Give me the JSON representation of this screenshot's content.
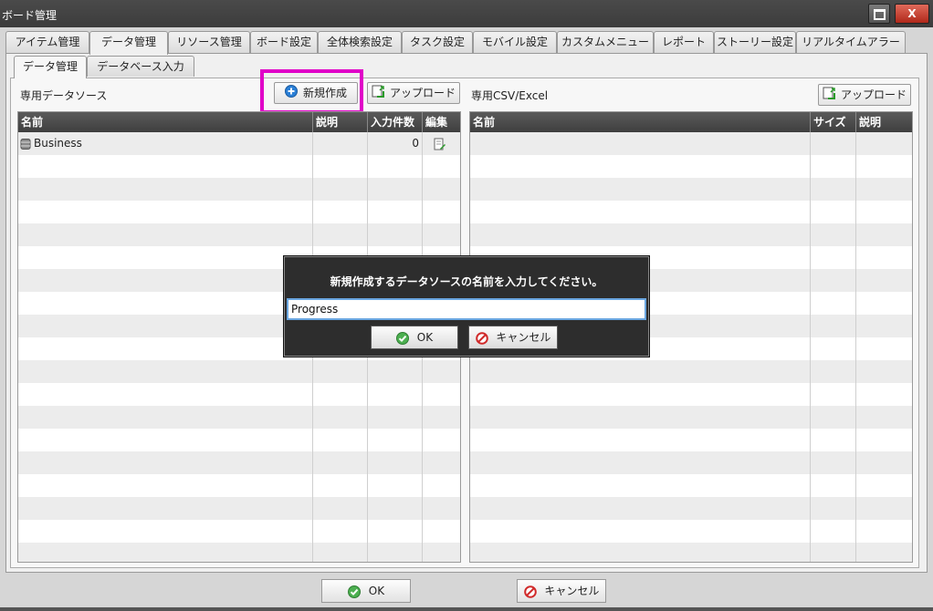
{
  "window": {
    "title": "ボード管理"
  },
  "main_tabs": [
    {
      "label": "アイテム管理"
    },
    {
      "label": "データ管理"
    },
    {
      "label": "リソース管理"
    },
    {
      "label": "ボード設定"
    },
    {
      "label": "全体検索設定"
    },
    {
      "label": "タスク設定"
    },
    {
      "label": "モバイル設定"
    },
    {
      "label": "カスタムメニュー"
    },
    {
      "label": "レポート"
    },
    {
      "label": "ストーリー設定"
    },
    {
      "label": "リアルタイムアラート"
    }
  ],
  "sub_tabs": [
    {
      "label": "データ管理"
    },
    {
      "label": "データベース入力"
    }
  ],
  "left_section": {
    "label": "専用データソース",
    "new_button": "新規作成",
    "upload_button": "アップロード",
    "columns": [
      "名前",
      "説明",
      "入力件数",
      "編集"
    ],
    "rows": [
      {
        "name": "Business",
        "description": "",
        "count": "0"
      }
    ]
  },
  "right_section": {
    "label": "専用CSV/Excel",
    "upload_button": "アップロード",
    "columns": [
      "名前",
      "サイズ",
      "説明"
    ]
  },
  "dialog": {
    "message": "新規作成するデータソースの名前を入力してください。",
    "input_value": "Progress",
    "ok_label": "OK",
    "cancel_label": "キャンセル"
  },
  "footer": {
    "ok_label": "OK",
    "cancel_label": "キャンセル"
  },
  "colors": {
    "highlight": "#e000c8",
    "header_bg": "#4a4a4a",
    "dialog_bg": "#2d2d2d"
  }
}
